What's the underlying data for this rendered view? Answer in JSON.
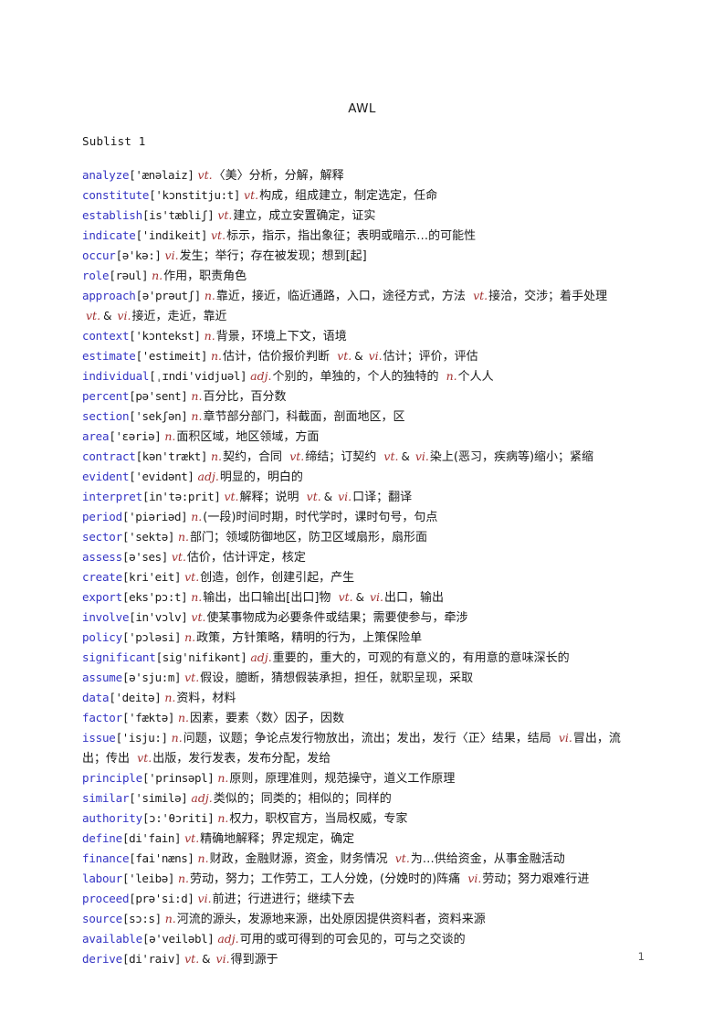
{
  "document": {
    "title": "AWL",
    "sublist_heading": "Sublist 1",
    "page_number": "1",
    "colors": {
      "headword": "#3434c4",
      "part_of_speech": "#a03030",
      "body_text": "#1a1a1a",
      "page_background": "#ffffff"
    }
  },
  "entries": [
    {
      "word": "analyze",
      "ipa": "['ænəlaiz]",
      "senses": [
        {
          "pos": "vt.",
          "def": "〈美〉分析，分解，解释"
        }
      ]
    },
    {
      "word": "constitute",
      "ipa": "['kɔnstitju:t]",
      "senses": [
        {
          "pos": "vt.",
          "def": "构成，组成建立，制定选定，任命"
        }
      ]
    },
    {
      "word": "establish",
      "ipa": "[is'tæbliʃ]",
      "senses": [
        {
          "pos": "vt.",
          "def": "建立，成立安置确定，证实"
        }
      ]
    },
    {
      "word": "indicate",
      "ipa": "['indikeit]",
      "senses": [
        {
          "pos": "vt.",
          "def": "标示，指示，指出象征；表明或暗示…的可能性"
        }
      ]
    },
    {
      "word": "occur",
      "ipa": "[ə'kə:]",
      "senses": [
        {
          "pos": "vi.",
          "def": "发生；举行；存在被发现；想到[起]"
        }
      ]
    },
    {
      "word": "role",
      "ipa": "[rəul]",
      "senses": [
        {
          "pos": "n.",
          "def": "作用，职责角色"
        }
      ]
    },
    {
      "word": "approach",
      "ipa": "[ə'prəutʃ]",
      "senses": [
        {
          "pos": "n.",
          "def": "靠近，接近，临近通路，入口，途径方式，方法"
        },
        {
          "pos": "vt.",
          "def": "接洽，交涉；着手处理"
        },
        {
          "pos": "vt.",
          "amp": "&",
          "pos2": "vi.",
          "def": "接近，走近，靠近"
        }
      ]
    },
    {
      "word": "context",
      "ipa": "['kɔntekst]",
      "senses": [
        {
          "pos": "n.",
          "def": "背景，环境上下文，语境"
        }
      ]
    },
    {
      "word": "estimate",
      "ipa": "['estimeit]",
      "senses": [
        {
          "pos": "n.",
          "def": "估计，估价报价判断"
        },
        {
          "pos": "vt.",
          "amp": "&",
          "pos2": "vi.",
          "def": "估计；评价，评估"
        }
      ]
    },
    {
      "word": "individual",
      "ipa": "[ˌɪndi'vidjuəl]",
      "senses": [
        {
          "pos": "adj.",
          "def": "个别的，单独的，个人的独特的"
        },
        {
          "pos": "n.",
          "def": "个人人"
        }
      ]
    },
    {
      "word": "percent",
      "ipa": "[pə'sent]",
      "senses": [
        {
          "pos": "n.",
          "def": "百分比，百分数"
        }
      ]
    },
    {
      "word": "section",
      "ipa": "['sekʃən]",
      "senses": [
        {
          "pos": "n.",
          "def": "章节部分部门，科截面，剖面地区，区"
        }
      ]
    },
    {
      "word": "area",
      "ipa": "['ɛəriə]",
      "senses": [
        {
          "pos": "n.",
          "def": "面积区域，地区领域，方面"
        }
      ]
    },
    {
      "word": "contract",
      "ipa": "[kən'trækt]",
      "senses": [
        {
          "pos": "n.",
          "def": "契约，合同"
        },
        {
          "pos": "vt.",
          "def": "缔结；订契约"
        },
        {
          "pos": "vt.",
          "amp": "&",
          "pos2": "vi.",
          "def": "染上(恶习，疾病等)缩小；紧缩"
        }
      ]
    },
    {
      "word": "evident",
      "ipa": "['evidənt]",
      "senses": [
        {
          "pos": "adj.",
          "def": "明显的，明白的"
        }
      ]
    },
    {
      "word": "interpret",
      "ipa": "[in'tə:prit]",
      "senses": [
        {
          "pos": "vt.",
          "def": "解释；说明"
        },
        {
          "pos": "vt.",
          "amp": "&",
          "pos2": "vi.",
          "def": "口译；翻译"
        }
      ]
    },
    {
      "word": "period",
      "ipa": "['piəriəd]",
      "senses": [
        {
          "pos": "n.",
          "def": "(一段)时间时期，时代学时，课时句号，句点"
        }
      ]
    },
    {
      "word": "sector",
      "ipa": "['sektə]",
      "senses": [
        {
          "pos": "n.",
          "def": "部门；领域防御地区，防卫区域扇形，扇形面"
        }
      ]
    },
    {
      "word": "assess",
      "ipa": "[ə'ses]",
      "senses": [
        {
          "pos": "vt.",
          "def": "估价，估计评定，核定"
        }
      ]
    },
    {
      "word": "create",
      "ipa": "[kri'eit]",
      "senses": [
        {
          "pos": "vt.",
          "def": "创造，创作，创建引起，产生"
        }
      ]
    },
    {
      "word": "export",
      "ipa": "[eks'pɔ:t]",
      "senses": [
        {
          "pos": "n.",
          "def": "输出，出口输出[出口]物"
        },
        {
          "pos": "vt.",
          "amp": "&",
          "pos2": "vi.",
          "def": "出口，输出"
        }
      ]
    },
    {
      "word": "involve",
      "ipa": "[in'vɔlv]",
      "senses": [
        {
          "pos": "vt.",
          "def": "使某事物成为必要条件或结果；需要使参与，牵涉"
        }
      ]
    },
    {
      "word": "policy",
      "ipa": "['pɔləsi]",
      "senses": [
        {
          "pos": "n.",
          "def": "政策，方针策略，精明的行为，上策保险单"
        }
      ]
    },
    {
      "word": "significant",
      "ipa": "[sig'nifikənt]",
      "senses": [
        {
          "pos": "adj.",
          "def": "重要的，重大的，可观的有意义的，有用意的意味深长的"
        }
      ]
    },
    {
      "word": "assume",
      "ipa": "[ə'sju:m]",
      "senses": [
        {
          "pos": "vt.",
          "def": "假设，臆断，猜想假装承担，担任，就职呈现，采取"
        }
      ]
    },
    {
      "word": "data",
      "ipa": "['deitə]",
      "senses": [
        {
          "pos": "n.",
          "def": "资料，材料"
        }
      ]
    },
    {
      "word": "factor",
      "ipa": "['fæktə]",
      "senses": [
        {
          "pos": "n.",
          "def": "因素，要素〈数〉因子，因数"
        }
      ]
    },
    {
      "word": "issue",
      "ipa": "['isju:]",
      "senses": [
        {
          "pos": "n.",
          "def": "问题，议题；争论点发行物放出，流出；发出，发行〈正〉结果，结局"
        },
        {
          "pos": "vi.",
          "def": "冒出，流出；传出"
        },
        {
          "pos": "vt.",
          "def": "出版，发行发表，发布分配，发给"
        }
      ]
    },
    {
      "word": "principle",
      "ipa": "['prinsəpl]",
      "senses": [
        {
          "pos": "n.",
          "def": "原则，原理准则，规范操守，道义工作原理"
        }
      ]
    },
    {
      "word": "similar",
      "ipa": "['similə]",
      "senses": [
        {
          "pos": "adj.",
          "def": "类似的；同类的；相似的；同样的"
        }
      ]
    },
    {
      "word": "authority",
      "ipa": "[ɔ:'θɔriti]",
      "senses": [
        {
          "pos": "n.",
          "def": "权力，职权官方，当局权威，专家"
        }
      ]
    },
    {
      "word": "define",
      "ipa": "[di'fain]",
      "senses": [
        {
          "pos": "vt.",
          "def": "精确地解释；界定规定，确定"
        }
      ]
    },
    {
      "word": "finance",
      "ipa": "[fai'næns]",
      "senses": [
        {
          "pos": "n.",
          "def": "财政，金融财源，资金，财务情况"
        },
        {
          "pos": "vt.",
          "def": "为…供给资金，从事金融活动"
        }
      ]
    },
    {
      "word": "labour",
      "ipa": "['leibə]",
      "senses": [
        {
          "pos": "n.",
          "def": "劳动，努力；工作劳工，工人分娩，(分娩时的)阵痛"
        },
        {
          "pos": "vi.",
          "def": "劳动；努力艰难行进"
        }
      ]
    },
    {
      "word": "proceed",
      "ipa": "[prə'si:d]",
      "senses": [
        {
          "pos": "vi.",
          "def": "前进；行进进行；继续下去"
        }
      ]
    },
    {
      "word": "source",
      "ipa": "[sɔ:s]",
      "senses": [
        {
          "pos": "n.",
          "def": "河流的源头，发源地来源，出处原因提供资料者，资料来源"
        }
      ]
    },
    {
      "word": "available",
      "ipa": "[ə'veiləbl]",
      "senses": [
        {
          "pos": "adj.",
          "def": "可用的或可得到的可会见的，可与之交谈的"
        }
      ]
    },
    {
      "word": "derive",
      "ipa": "[di'raiv]",
      "senses": [
        {
          "pos": "vt.",
          "amp": "&",
          "pos2": "vi.",
          "def": "得到源于"
        }
      ]
    }
  ]
}
